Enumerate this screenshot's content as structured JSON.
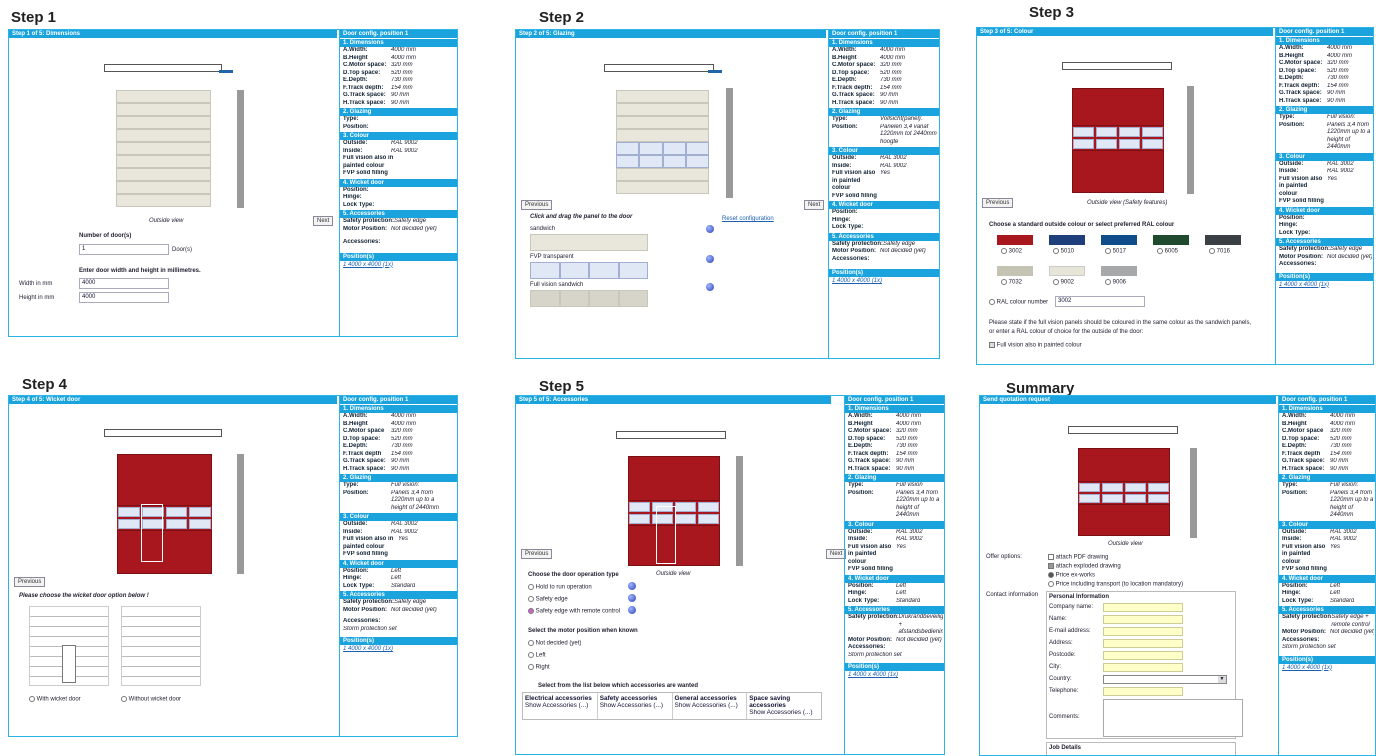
{
  "step_titles": [
    "Step 1",
    "Step 2",
    "Step 3",
    "Step 4",
    "Step 5",
    "Summary"
  ],
  "headers": {
    "s1": "Step 1 of 5: Dimensions",
    "s2": "Step 2 of 5: Glazing",
    "s3": "Step 3 of 5: Colour",
    "s4": "Step 4 of 5: Wicket door",
    "s5": "Step 5 of 5: Accessories",
    "sum": "Send quotation request"
  },
  "cfg_title": "Door config. position 1",
  "sections": {
    "dim": "1. Dimensions",
    "glaz": "2. Glazing",
    "col": "3. Colour",
    "wick": "4. Wicket door",
    "acc": "5. Accessories",
    "pos": "Position(s)"
  },
  "dims1": [
    [
      "A.Width:",
      "4000 mm"
    ],
    [
      "B.Height",
      "4000 mm"
    ],
    [
      "C.Motor space:",
      "320 mm"
    ],
    [
      "D.Top space:",
      "520 mm"
    ],
    [
      "E.Depth:",
      "730 mm"
    ],
    [
      "F.Track depth:",
      "154 mm"
    ],
    [
      "G.Track space:",
      "90 mm"
    ],
    [
      "H.Track space:",
      "90 mm"
    ]
  ],
  "glazing1": [
    [
      "Type:",
      ""
    ],
    [
      "Position:",
      ""
    ]
  ],
  "colour1": [
    [
      "Outside:",
      "RAL 9002"
    ],
    [
      "Inside:",
      "RAL 9002"
    ],
    [
      "Full vision also in painted colour",
      ""
    ],
    [
      "FVP solid filling",
      ""
    ]
  ],
  "wicket1": [
    [
      "Position:",
      ""
    ],
    [
      "Hinge:",
      ""
    ],
    [
      "Lock Type:",
      ""
    ]
  ],
  "acc1": [
    [
      "Safety protection:",
      "Safety edge"
    ],
    [
      "Motor Position:",
      "Not decided (yet)"
    ],
    [
      "Accessories:",
      ""
    ]
  ],
  "position": "1   4000 x 4000 (1x)",
  "s1": {
    "outside_view": "Outside view",
    "num_doors_label": "Number of door(s)",
    "num_doors": "1",
    "doors_unit": "Door(s)",
    "enter": "Enter door width and height in millimetres.",
    "width_label": "Width in mm",
    "height_label": "Height in mm",
    "width": "4000",
    "height": "4000",
    "next": "Next"
  },
  "s2": {
    "prev": "Previous",
    "next": "Next",
    "instr": "Click and drag the panel to the door",
    "reset": "Reset configuration",
    "p1": "sandwich",
    "p2": "FVP transparent",
    "p3": "Full vision sandwich"
  },
  "glazing2": [
    [
      "Type:",
      "Vollsicht(panel):"
    ],
    [
      "Position:",
      "Panelen 3,4 vanaf 1220mm tot 2440mm hoogte"
    ]
  ],
  "colour2": [
    [
      "Outside:",
      "RAL 3002"
    ],
    [
      "Inside:",
      "RAL 9002"
    ],
    [
      "Full vision also in painted colour",
      "Yes"
    ],
    [
      "FVP solid filling",
      ""
    ]
  ],
  "acc2": [
    [
      "Safety protection:",
      "Safety edge"
    ],
    [
      "Motor Position:",
      "Not decided (yet)"
    ],
    [
      "Accessories:",
      ""
    ]
  ],
  "s3": {
    "prev": "Previous",
    "outside_view": "Outside view (Safety features)",
    "choose": "Choose a standard outside colour or select preferred RAL colour",
    "colours": [
      {
        "code": "3002",
        "hex": "#a8161e"
      },
      {
        "code": "5010",
        "hex": "#1e3f7a"
      },
      {
        "code": "5017",
        "hex": "#0f4d8a"
      },
      {
        "code": "6005",
        "hex": "#1f4a2e"
      },
      {
        "code": "7016",
        "hex": "#3a4046"
      },
      {
        "code": "7032",
        "hex": "#c5c4b4"
      },
      {
        "code": "9002",
        "hex": "#e7e5d8"
      },
      {
        "code": "9006",
        "hex": "#a6a8aa"
      }
    ],
    "ral_label": "RAL colour number",
    "ral_value": "3002",
    "note1": "Please state if the full vision panels should be coloured in the same colour as the sandwich panels,",
    "note2": "or enter a RAL colour of choice for the outside of the door:",
    "full": "Full vision also in painted colour"
  },
  "glazing3": [
    [
      "Type:",
      "Full vision:"
    ],
    [
      "Position:",
      "Panels 3,4 from 1220mm up to a height of 2440mm"
    ]
  ],
  "colour3": [
    [
      "Outside:",
      "RAL 3002"
    ],
    [
      "Inside:",
      "RAL 9002"
    ],
    [
      "Full vision also in painted colour",
      "Yes"
    ],
    [
      "FVP solid filling",
      ""
    ]
  ],
  "s4": {
    "prev": "Previous",
    "choose": "Please choose the wicket door option below !",
    "with": "With wicket door",
    "without": "Without wicket door"
  },
  "dims4": [
    [
      "A.Width:",
      "4000 mm"
    ],
    [
      "B.Height",
      "4000 mm"
    ],
    [
      "C.Motor space",
      "320 mm"
    ],
    [
      "D.Top space:",
      "520 mm"
    ],
    [
      "E.Depth:",
      "730 mm"
    ],
    [
      "F.Track depth",
      "154 mm"
    ],
    [
      "G.Track space:",
      "90 mm"
    ],
    [
      "H.Track space:",
      "90 mm"
    ]
  ],
  "glazing4": [
    [
      "Type:",
      "Full vision:"
    ],
    [
      "Position:",
      "Panels 3,4 from 1220mm up to a height of 2440mm"
    ]
  ],
  "colour4": [
    [
      "Outside:",
      "RAL 3002"
    ],
    [
      "Inside:",
      "RAL 9002"
    ],
    [
      "Full vision also in painted colour",
      "Yes"
    ],
    [
      "FVP solid filling",
      ""
    ]
  ],
  "wicket4": [
    [
      "Position:",
      "Left"
    ],
    [
      "Hinge:",
      "Left"
    ],
    [
      "Lock Type:",
      "Standard"
    ]
  ],
  "acc4": [
    [
      "Safety protection:",
      "Safety edge"
    ],
    [
      "Motor Position:",
      "Not decided (yet)"
    ],
    [
      "Accessories:",
      ""
    ],
    [
      "Storm protection set",
      ""
    ]
  ],
  "s5": {
    "prev": "Previous",
    "next": "Next",
    "outside_view": "Outside view",
    "op_title": "Choose the door operation type",
    "op1": "Hold to run operation",
    "op2": "Safety edge",
    "op3": "Safety edge with remote control",
    "motor_title": "Select the motor position when known",
    "m1": "Not decided (yet)",
    "m2": "Left",
    "m3": "Right",
    "acc_title": "Select from the list below which accessories are wanted",
    "cats": [
      {
        "t": "Electrical accessories",
        "s": "Show Accessories (...)"
      },
      {
        "t": "Safety accessories",
        "s": "Show Accessories (...)"
      },
      {
        "t": "General accessories",
        "s": "Show Accessories (...)"
      },
      {
        "t": "Space saving accessories",
        "s": "Show Accessories (...)"
      }
    ]
  },
  "glazing5": [
    [
      "Type:",
      "Full vision"
    ],
    [
      "Position:",
      "Panels 3,4 from 1220mm up to a height of 2440mm"
    ]
  ],
  "colour5": [
    [
      "Outside:",
      "RAL 3002"
    ],
    [
      "Inside:",
      "RAL 9002"
    ],
    [
      "Full vision also in painted colour",
      "Yes"
    ],
    [
      "FVP solid filling",
      ""
    ]
  ],
  "wicket5": [
    [
      "Position:",
      "Left"
    ],
    [
      "Hinge:",
      "Left"
    ],
    [
      "Lock Type:",
      "Standard"
    ]
  ],
  "acc5": [
    [
      "Safety protection:",
      "Drukrandbeveiliging + afstandsbediening"
    ],
    [
      "Motor Position:",
      "Not decided (yet)"
    ],
    [
      "Accessories:",
      ""
    ],
    [
      "Storm protection set",
      ""
    ]
  ],
  "sum": {
    "outside_view": "Outside view",
    "offer": "Offer options:",
    "o1": "attach PDF drawing",
    "o2": "attach exploded drawing",
    "o3": "Price ex-works",
    "o4": "Price including transport (to location mandatory)",
    "contact": "Contact information",
    "personal": "Personal Information",
    "fields": [
      "Company name:",
      "Name:",
      "E-mail address:",
      "Address:",
      "Postcode:",
      "City:",
      "Country:",
      "Telephone:",
      "Comments:"
    ],
    "job": "Job Details"
  },
  "wicket_sum": [
    [
      "Position:",
      "Left"
    ],
    [
      "Hinge:",
      "Left"
    ],
    [
      "Lock Type:",
      "Standard"
    ]
  ],
  "acc_sum": [
    [
      "Safety protection:",
      "Safety edge + remote control"
    ],
    [
      "Motor Position:",
      "Not decided (yet)"
    ],
    [
      "Accessories:",
      ""
    ],
    [
      "Storm protection set",
      ""
    ]
  ]
}
